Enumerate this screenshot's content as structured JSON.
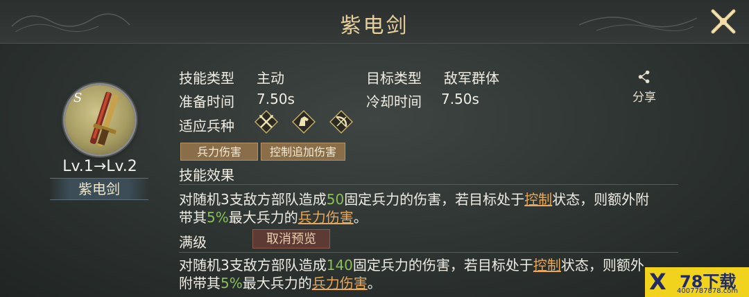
{
  "header": {
    "title": "紫电剑"
  },
  "skill": {
    "rank": "S",
    "level_text": "Lv.1→Lv.2",
    "name": "紫电剑"
  },
  "attributes": {
    "skill_type_label": "技能类型",
    "skill_type_value": "主动",
    "target_type_label": "目标类型",
    "target_type_value": "敌军群体",
    "prep_time_label": "准备时间",
    "prep_time_value": "7.50s",
    "cooldown_label": "冷却时间",
    "cooldown_value": "7.50s",
    "troop_label": "适应兵种",
    "troop_icons": [
      "spear-icon",
      "cavalry-icon",
      "bow-icon"
    ]
  },
  "share": {
    "label": "分享"
  },
  "tags": [
    "兵力伤害",
    "控制追加伤害"
  ],
  "effect": {
    "label": "技能效果",
    "line1_a": "对随机3支敌方部队造成",
    "line1_num": "50",
    "line1_b": "固定兵力的伤害，若目标处于",
    "line1_kw": "控制",
    "line1_c": "状态，则额外附",
    "line2_a": "带其",
    "line2_num": "5%",
    "line2_b": "最大兵力的",
    "line2_kw": "兵力伤害",
    "line2_c": "。"
  },
  "max_level": {
    "label": "满级",
    "cancel_button": "取消预览",
    "line1_a": "对随机3支敌方部队造成",
    "line1_num": "140",
    "line1_b": "固定兵力的伤害，若目标处于",
    "line1_kw": "控制",
    "line1_c": "状态，则额外",
    "line2_a": "附带其",
    "line2_num": "5%",
    "line2_b": "最大兵力的",
    "line2_kw": "兵力伤害",
    "line2_c": "。"
  },
  "watermark": {
    "big": "78下载",
    "small": "4007787878.com"
  },
  "colors": {
    "accent_gold": "#e7cf9c",
    "number_green": "#88c05a",
    "keyword_orange": "#e7a85a"
  }
}
